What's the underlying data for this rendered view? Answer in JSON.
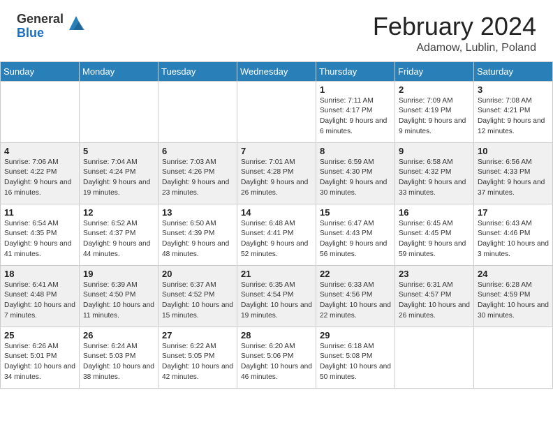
{
  "header": {
    "logo_general": "General",
    "logo_blue": "Blue",
    "month_year": "February 2024",
    "location": "Adamow, Lublin, Poland"
  },
  "days_of_week": [
    "Sunday",
    "Monday",
    "Tuesday",
    "Wednesday",
    "Thursday",
    "Friday",
    "Saturday"
  ],
  "weeks": [
    [
      {
        "day": "",
        "info": ""
      },
      {
        "day": "",
        "info": ""
      },
      {
        "day": "",
        "info": ""
      },
      {
        "day": "",
        "info": ""
      },
      {
        "day": "1",
        "info": "Sunrise: 7:11 AM\nSunset: 4:17 PM\nDaylight: 9 hours\nand 6 minutes."
      },
      {
        "day": "2",
        "info": "Sunrise: 7:09 AM\nSunset: 4:19 PM\nDaylight: 9 hours\nand 9 minutes."
      },
      {
        "day": "3",
        "info": "Sunrise: 7:08 AM\nSunset: 4:21 PM\nDaylight: 9 hours\nand 12 minutes."
      }
    ],
    [
      {
        "day": "4",
        "info": "Sunrise: 7:06 AM\nSunset: 4:22 PM\nDaylight: 9 hours\nand 16 minutes."
      },
      {
        "day": "5",
        "info": "Sunrise: 7:04 AM\nSunset: 4:24 PM\nDaylight: 9 hours\nand 19 minutes."
      },
      {
        "day": "6",
        "info": "Sunrise: 7:03 AM\nSunset: 4:26 PM\nDaylight: 9 hours\nand 23 minutes."
      },
      {
        "day": "7",
        "info": "Sunrise: 7:01 AM\nSunset: 4:28 PM\nDaylight: 9 hours\nand 26 minutes."
      },
      {
        "day": "8",
        "info": "Sunrise: 6:59 AM\nSunset: 4:30 PM\nDaylight: 9 hours\nand 30 minutes."
      },
      {
        "day": "9",
        "info": "Sunrise: 6:58 AM\nSunset: 4:32 PM\nDaylight: 9 hours\nand 33 minutes."
      },
      {
        "day": "10",
        "info": "Sunrise: 6:56 AM\nSunset: 4:33 PM\nDaylight: 9 hours\nand 37 minutes."
      }
    ],
    [
      {
        "day": "11",
        "info": "Sunrise: 6:54 AM\nSunset: 4:35 PM\nDaylight: 9 hours\nand 41 minutes."
      },
      {
        "day": "12",
        "info": "Sunrise: 6:52 AM\nSunset: 4:37 PM\nDaylight: 9 hours\nand 44 minutes."
      },
      {
        "day": "13",
        "info": "Sunrise: 6:50 AM\nSunset: 4:39 PM\nDaylight: 9 hours\nand 48 minutes."
      },
      {
        "day": "14",
        "info": "Sunrise: 6:48 AM\nSunset: 4:41 PM\nDaylight: 9 hours\nand 52 minutes."
      },
      {
        "day": "15",
        "info": "Sunrise: 6:47 AM\nSunset: 4:43 PM\nDaylight: 9 hours\nand 56 minutes."
      },
      {
        "day": "16",
        "info": "Sunrise: 6:45 AM\nSunset: 4:45 PM\nDaylight: 9 hours\nand 59 minutes."
      },
      {
        "day": "17",
        "info": "Sunrise: 6:43 AM\nSunset: 4:46 PM\nDaylight: 10 hours\nand 3 minutes."
      }
    ],
    [
      {
        "day": "18",
        "info": "Sunrise: 6:41 AM\nSunset: 4:48 PM\nDaylight: 10 hours\nand 7 minutes."
      },
      {
        "day": "19",
        "info": "Sunrise: 6:39 AM\nSunset: 4:50 PM\nDaylight: 10 hours\nand 11 minutes."
      },
      {
        "day": "20",
        "info": "Sunrise: 6:37 AM\nSunset: 4:52 PM\nDaylight: 10 hours\nand 15 minutes."
      },
      {
        "day": "21",
        "info": "Sunrise: 6:35 AM\nSunset: 4:54 PM\nDaylight: 10 hours\nand 19 minutes."
      },
      {
        "day": "22",
        "info": "Sunrise: 6:33 AM\nSunset: 4:56 PM\nDaylight: 10 hours\nand 22 minutes."
      },
      {
        "day": "23",
        "info": "Sunrise: 6:31 AM\nSunset: 4:57 PM\nDaylight: 10 hours\nand 26 minutes."
      },
      {
        "day": "24",
        "info": "Sunrise: 6:28 AM\nSunset: 4:59 PM\nDaylight: 10 hours\nand 30 minutes."
      }
    ],
    [
      {
        "day": "25",
        "info": "Sunrise: 6:26 AM\nSunset: 5:01 PM\nDaylight: 10 hours\nand 34 minutes."
      },
      {
        "day": "26",
        "info": "Sunrise: 6:24 AM\nSunset: 5:03 PM\nDaylight: 10 hours\nand 38 minutes."
      },
      {
        "day": "27",
        "info": "Sunrise: 6:22 AM\nSunset: 5:05 PM\nDaylight: 10 hours\nand 42 minutes."
      },
      {
        "day": "28",
        "info": "Sunrise: 6:20 AM\nSunset: 5:06 PM\nDaylight: 10 hours\nand 46 minutes."
      },
      {
        "day": "29",
        "info": "Sunrise: 6:18 AM\nSunset: 5:08 PM\nDaylight: 10 hours\nand 50 minutes."
      },
      {
        "day": "",
        "info": ""
      },
      {
        "day": "",
        "info": ""
      }
    ]
  ]
}
